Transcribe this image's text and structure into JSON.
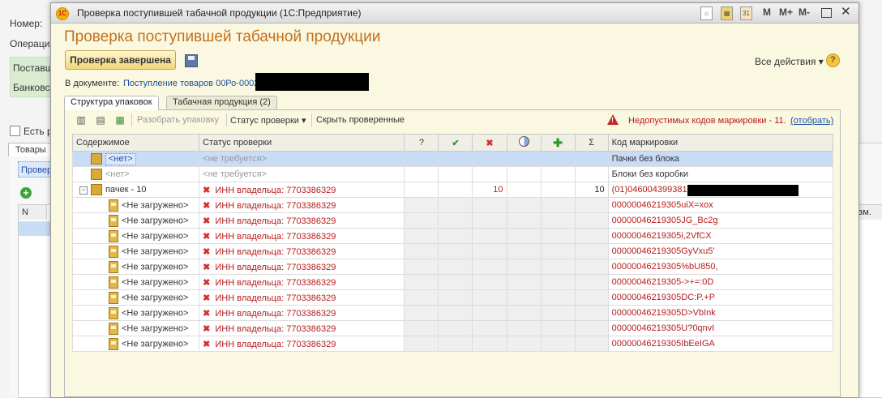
{
  "background_form": {
    "labels": [
      "Номер:",
      "Операция"
    ],
    "green_labels": [
      "Поставщ",
      "Банковс"
    ],
    "checkbox_label": "Есть р",
    "tab_label": "Товары",
    "selected_button": "Провер",
    "table_header_first": "N",
    "table_header_last": "изм.",
    "row_number": "1"
  },
  "window": {
    "title": "Проверка поступившей табачной продукции  (1С:Предприятие)",
    "title_icons": [
      "home-icon",
      "calculator-icon",
      "calendar-icon",
      "M",
      "M+",
      "M-",
      "maximize-icon",
      "close-icon"
    ]
  },
  "form": {
    "title": "Проверка поступившей табачной продукции",
    "done_button": "Проверка завершена",
    "all_actions": "Все действия ▾",
    "doc_label": "В документе:",
    "doc_link": "Поступление товаров 00Ро-0002"
  },
  "tabs": [
    {
      "label": "Структура упаковок",
      "active": true
    },
    {
      "label": "Табачная продукция (2)",
      "active": false
    }
  ],
  "toolbar": {
    "unpack": "Разобрать упаковку",
    "status": "Статус проверки ▾",
    "hide_checked": "Скрыть проверенные",
    "warning_text": "Недопустимых кодов маркировки - 11.",
    "warning_link": "(отобрать)"
  },
  "grid": {
    "headers": {
      "content": "Содержимое",
      "status": "Статус проверки",
      "q": "?",
      "sum": "Σ",
      "code": "Код маркировки"
    },
    "rows": [
      {
        "content": "<нет>",
        "status": "<не требуется>",
        "x": "",
        "sum": "",
        "code": "Пачки без блока",
        "kind": "top-selected"
      },
      {
        "content": "<нет>",
        "status": "<не требуется>",
        "x": "",
        "sum": "",
        "code": "Блоки без коробки",
        "kind": "top"
      },
      {
        "content": "пачек - 10",
        "status": "ИНН владельца: 7703386329",
        "x": "10",
        "sum": "10",
        "code": "(01)04600439938​16",
        "kind": "group"
      },
      {
        "content": "<Не загружено>",
        "status": "ИНН владельца: 7703386329",
        "x": "",
        "sum": "",
        "code": "00000046219305uiX=xox",
        "kind": "item"
      },
      {
        "content": "<Не загружено>",
        "status": "ИНН владельца: 7703386329",
        "x": "",
        "sum": "",
        "code": "00000046219305JG_Bc2g",
        "kind": "item"
      },
      {
        "content": "<Не загружено>",
        "status": "ИНН владельца: 7703386329",
        "x": "",
        "sum": "",
        "code": "00000046219305i,2VfCX",
        "kind": "item"
      },
      {
        "content": "<Не загружено>",
        "status": "ИНН владельца: 7703386329",
        "x": "",
        "sum": "",
        "code": "00000046219305GyVxu5'",
        "kind": "item"
      },
      {
        "content": "<Не загружено>",
        "status": "ИНН владельца: 7703386329",
        "x": "",
        "sum": "",
        "code": "00000046219305%bU850,",
        "kind": "item"
      },
      {
        "content": "<Не загружено>",
        "status": "ИНН владельца: 7703386329",
        "x": "",
        "sum": "",
        "code": "00000046219305->+=:0D",
        "kind": "item"
      },
      {
        "content": "<Не загружено>",
        "status": "ИНН владельца: 7703386329",
        "x": "",
        "sum": "",
        "code": "00000046219305DC:P.+P",
        "kind": "item"
      },
      {
        "content": "<Не загружено>",
        "status": "ИНН владельца: 7703386329",
        "x": "",
        "sum": "",
        "code": "00000046219305D>VbInk",
        "kind": "item"
      },
      {
        "content": "<Не загружено>",
        "status": "ИНН владельца: 7703386329",
        "x": "",
        "sum": "",
        "code": "00000046219305U?0qnvI",
        "kind": "item"
      },
      {
        "content": "<Не загружено>",
        "status": "ИНН владельца: 7703386329",
        "x": "",
        "sum": "",
        "code": "00000046219305IbEeIGA",
        "kind": "item"
      }
    ]
  },
  "colors": {
    "accent": "#c2701b",
    "error": "#b71c1c",
    "selection": "#c8dcf5"
  }
}
